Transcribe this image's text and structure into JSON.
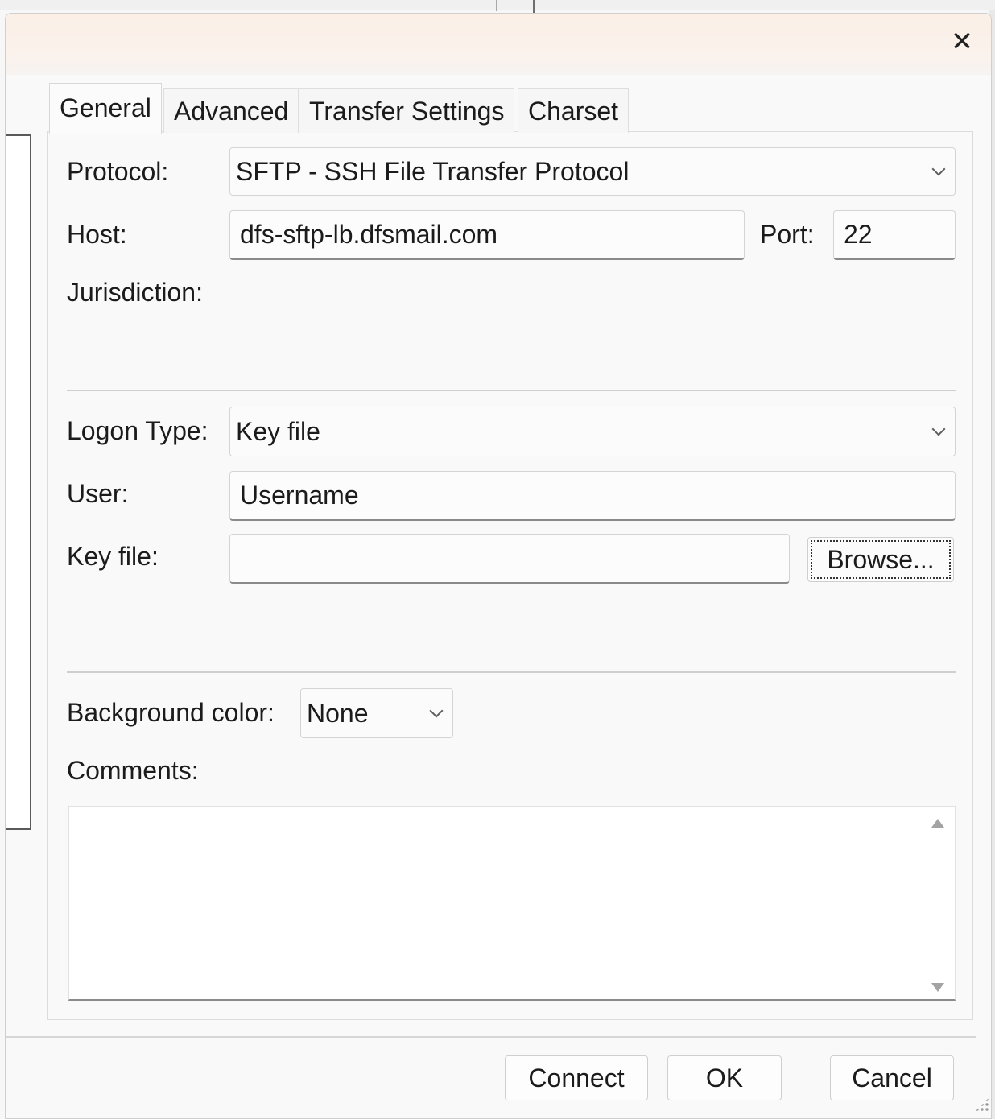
{
  "dialog": {
    "close_glyph": "✕"
  },
  "tabs": [
    {
      "label": "General",
      "active": true
    },
    {
      "label": "Advanced",
      "active": false
    },
    {
      "label": "Transfer Settings",
      "active": false
    },
    {
      "label": "Charset",
      "active": false
    }
  ],
  "general": {
    "protocol": {
      "label": "Protocol:",
      "value": "SFTP - SSH File Transfer Protocol"
    },
    "host": {
      "label": "Host:",
      "value": "dfs-sftp-lb.dfsmail.com"
    },
    "port": {
      "label": "Port:",
      "value": "22"
    },
    "jurisdiction": {
      "label": "Jurisdiction:"
    },
    "logon_type": {
      "label": "Logon Type:",
      "value": "Key file"
    },
    "user": {
      "label": "User:",
      "value": "Username"
    },
    "key_file": {
      "label": "Key file:",
      "value": "",
      "browse_label": "Browse..."
    },
    "background_color": {
      "label": "Background color:",
      "value": "None"
    },
    "comments": {
      "label": "Comments:",
      "value": ""
    }
  },
  "footer": {
    "connect_label": "Connect",
    "ok_label": "OK",
    "cancel_label": "Cancel"
  }
}
